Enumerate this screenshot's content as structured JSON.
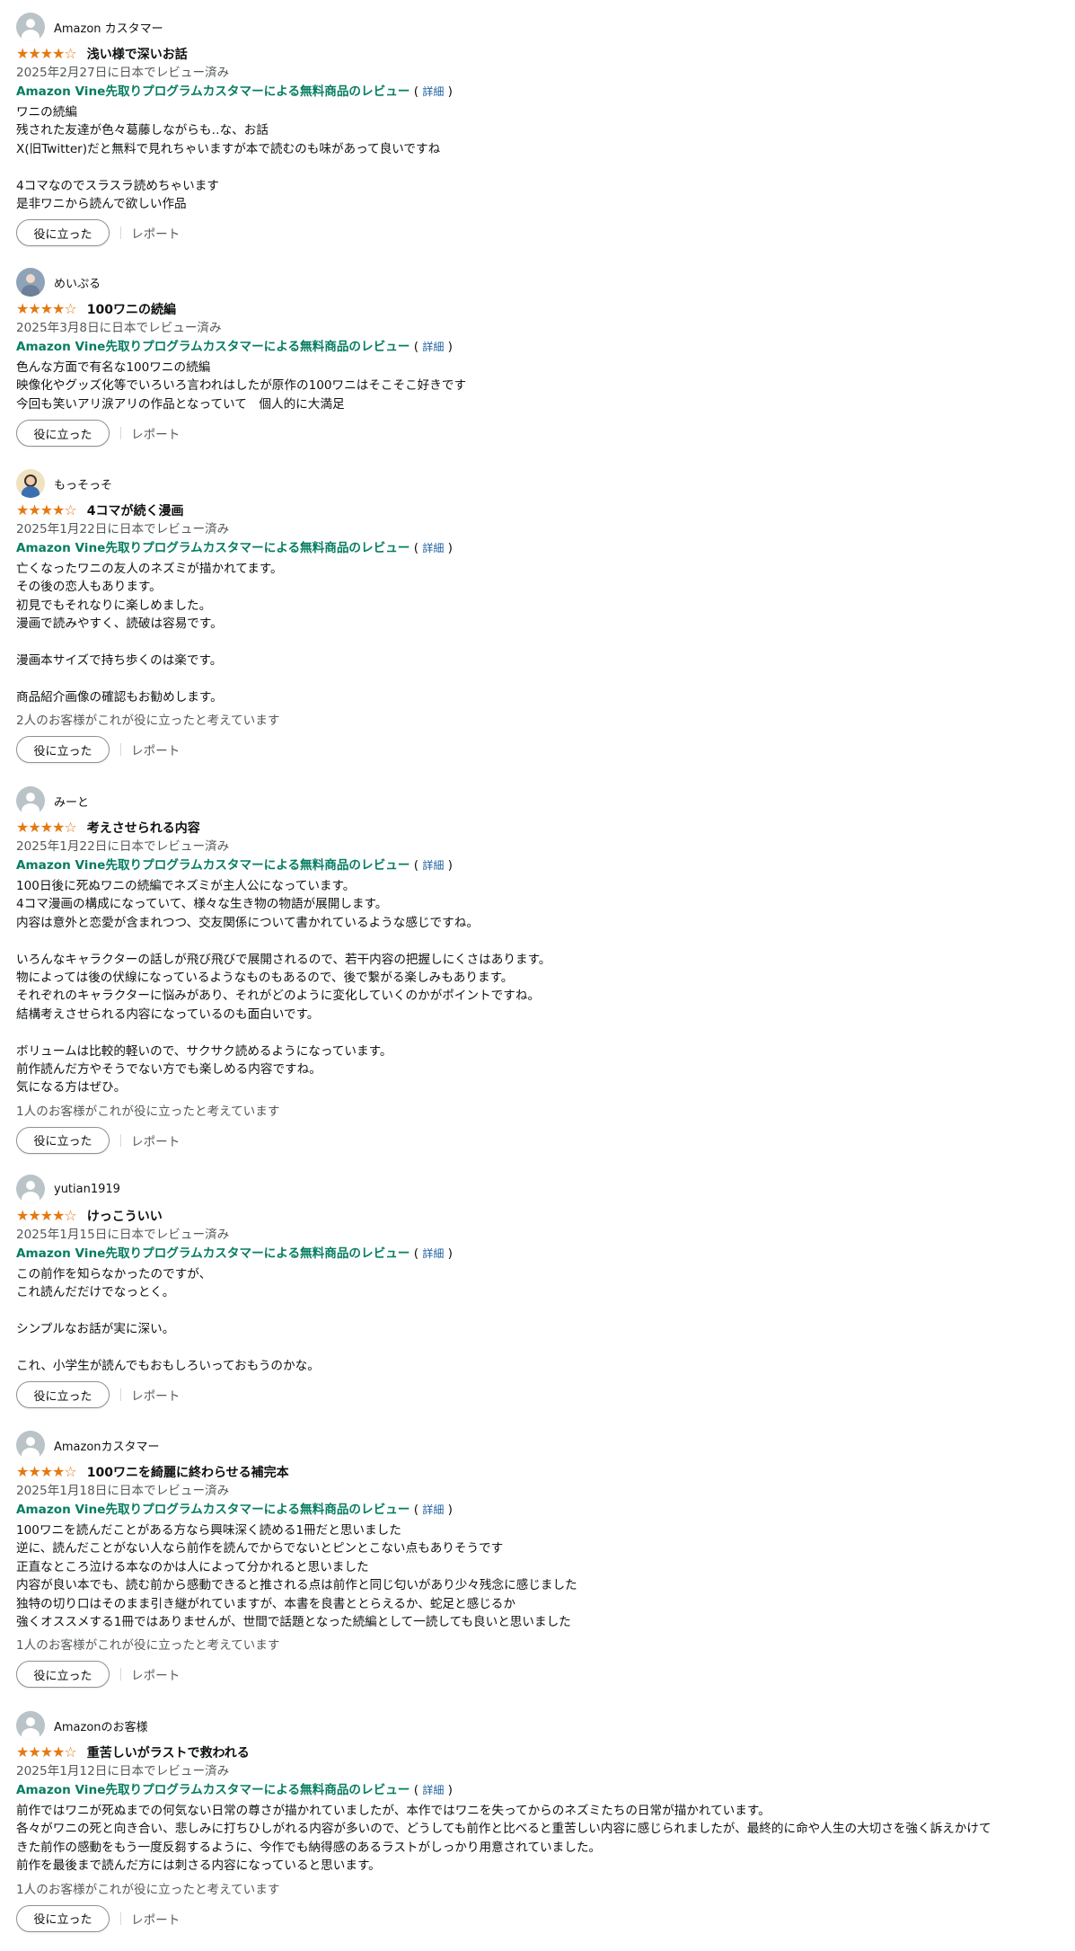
{
  "colors": {
    "star": "#e47911",
    "vine_green": "#067d62",
    "link_blue": "#2162a1",
    "muted_text": "#565959",
    "body_text": "#0f1111"
  },
  "common": {
    "stars": "★★★★☆",
    "vine_label": "Amazon Vine先取りプログラムカスタマーによる無料商品のレビュー",
    "vine_open": " ( ",
    "vine_link": "詳細",
    "vine_close": " )",
    "helpful_button": "役に立った",
    "report_link": "レポート",
    "rating_out_of_5": 4
  },
  "reviews": [
    {
      "profile_name": "Amazon カスタマー",
      "avatar_icon": "default-avatar-icon",
      "title": "浅い様で深いお話",
      "date": "2025年2月27日に日本でレビュー済み",
      "body": "ワニの続編\n残された友達が色々葛藤しながらも‥な、お話\nX(旧Twitter)だと無料で見れちゃいますが本で読むのも味があって良いですね\n\n4コマなのでスラスラ読めちゃいます\n是非ワニから読んで欲しい作品",
      "helpful_count": ""
    },
    {
      "profile_name": "めいぷる",
      "avatar_icon": "user-photo-avatar",
      "title": "100ワニの続編",
      "date": "2025年3月8日に日本でレビュー済み",
      "body": "色んな方面で有名な100ワニの続編\n映像化やグッズ化等でいろいろ言われはしたが原作の100ワニはそこそこ好きです\n今回も笑いアリ涙アリの作品となっていて　個人的に大満足",
      "helpful_count": ""
    },
    {
      "profile_name": "もっそっそ",
      "avatar_icon": "user-photo-avatar",
      "title": "4コマが続く漫画",
      "date": "2025年1月22日に日本でレビュー済み",
      "body": "亡くなったワニの友人のネズミが描かれてます。\nその後の恋人もあります。\n初見でもそれなりに楽しめました。\n漫画で読みやすく、読破は容易です。\n\n漫画本サイズで持ち歩くのは楽です。\n\n商品紹介画像の確認もお勧めします。",
      "helpful_count": "2人のお客様がこれが役に立ったと考えています"
    },
    {
      "profile_name": "みーと",
      "avatar_icon": "default-avatar-icon",
      "title": "考えさせられる内容",
      "date": "2025年1月22日に日本でレビュー済み",
      "body": "100日後に死ぬワニの続編でネズミが主人公になっています。\n4コマ漫画の構成になっていて、様々な生き物の物語が展開します。\n内容は意外と恋愛が含まれつつ、交友関係について書かれているような感じですね。\n\nいろんなキャラクターの話しが飛び飛びで展開されるので、若干内容の把握しにくさはあります。\n物によっては後の伏線になっているようなものもあるので、後で繋がる楽しみもあります。\nそれぞれのキャラクターに悩みがあり、それがどのように変化していくのかがポイントですね。\n結構考えさせられる内容になっているのも面白いです。\n\nボリュームは比較的軽いので、サクサク読めるようになっています。\n前作読んだ方やそうでない方でも楽しめる内容ですね。\n気になる方はぜひ。",
      "helpful_count": "1人のお客様がこれが役に立ったと考えています"
    },
    {
      "profile_name": "yutian1919",
      "avatar_icon": "default-avatar-icon",
      "title": "けっこういい",
      "date": "2025年1月15日に日本でレビュー済み",
      "body": "この前作を知らなかったのですが、\nこれ読んだだけでなっとく。\n\nシンプルなお話が実に深い。\n\nこれ、小学生が読んでもおもしろいっておもうのかな。",
      "helpful_count": ""
    },
    {
      "profile_name": "Amazonカスタマー",
      "avatar_icon": "default-avatar-icon",
      "title": "100ワニを綺麗に終わらせる補完本",
      "date": "2025年1月18日に日本でレビュー済み",
      "body": "100ワニを読んだことがある方なら興味深く読める1冊だと思いました\n逆に、読んだことがない人なら前作を読んでからでないとピンとこない点もありそうです\n正直なところ泣ける本なのかは人によって分かれると思いました\n内容が良い本でも、読む前から感動できると推される点は前作と同じ匂いがあり少々残念に感じました\n独特の切り口はそのまま引き継がれていますが、本書を良書ととらえるか、蛇足と感じるか\n強くオススメする1冊ではありませんが、世間で話題となった続編として一読しても良いと思いました",
      "helpful_count": "1人のお客様がこれが役に立ったと考えています"
    },
    {
      "profile_name": "Amazonのお客様",
      "avatar_icon": "default-avatar-icon",
      "title": "重苦しいがラストで救われる",
      "date": "2025年1月12日に日本でレビュー済み",
      "body": "前作ではワニが死ぬまでの何気ない日常の尊さが描かれていましたが、本作ではワニを失ってからのネズミたちの日常が描かれています。\n各々がワニの死と向き合い、悲しみに打ちひしがれる内容が多いので、どうしても前作と比べると重苦しい内容に感じられましたが、最終的に命や人生の大切さを強く訴えかけて\nきた前作の感動をもう一度反芻するように、今作でも納得感のあるラストがしっかり用意されていました。\n前作を最後まで読んだ方には刺さる内容になっていると思います。",
      "helpful_count": "1人のお客様がこれが役に立ったと考えています"
    }
  ]
}
